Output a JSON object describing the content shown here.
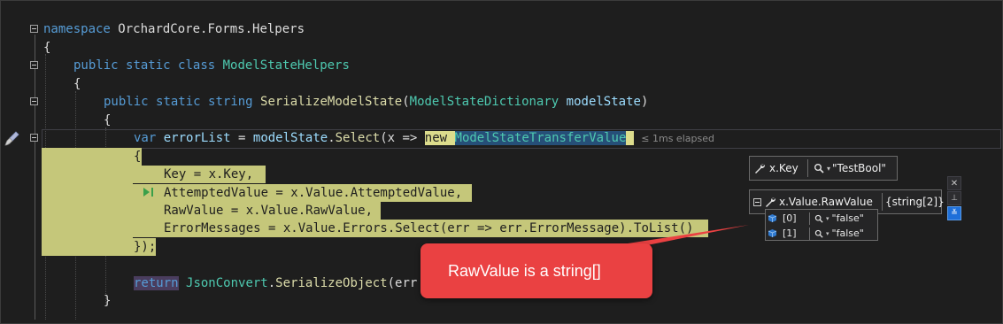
{
  "editor": {
    "lines": {
      "l1": {
        "kw": "namespace",
        "name": "OrchardCore.Forms.Helpers"
      },
      "l2": {
        "text": "{"
      },
      "l3": {
        "kw1": "public",
        "kw2": "static",
        "kw3": "class",
        "name": "ModelStateHelpers"
      },
      "l4": {
        "text": "{"
      },
      "l5": {
        "kw1": "public",
        "kw2": "static",
        "kw3": "string",
        "method": "SerializeModelState",
        "open": "(",
        "ptype": "ModelStateDictionary",
        "pname": "modelState",
        "close": ")"
      },
      "l6": {
        "text": "{"
      },
      "l7": {
        "kw": "var",
        "varname": "errorList",
        "eq": " = ",
        "obj": "modelState",
        "dot": ".",
        "call": "Select",
        "lambda_param": "(x",
        "arrow": " => ",
        "new_kw": "new",
        "type": "ModelStateTransferValue",
        "elapsed": "≤ 1ms elapsed"
      },
      "l8": {
        "text": "{"
      },
      "l9": {
        "text": "Key = x.Key,"
      },
      "l10": {
        "text": "AttemptedValue = x.Value.AttemptedValue,"
      },
      "l11": {
        "text": "RawValue = x.Value.RawValue,"
      },
      "l12": {
        "text": "ErrorMessages = x.Value.Errors.Select(err => err.ErrorMessage).ToList()"
      },
      "l13": {
        "text": "});"
      },
      "l15": {
        "kw": "return",
        "type": "JsonConvert",
        "dot": ".",
        "call": "SerializeObject",
        "args": "(err"
      },
      "l16": {
        "text": "}"
      }
    }
  },
  "datatips": {
    "key": {
      "name": "x.Key",
      "value": "\"TestBool\""
    },
    "rawvalue": {
      "name": "x.Value.RawValue",
      "value": "{string[2]}",
      "items": [
        {
          "index": "[0]",
          "value": "\"false\""
        },
        {
          "index": "[1]",
          "value": "\"false\""
        }
      ]
    }
  },
  "callout": {
    "text": "RawValue is a string[]"
  },
  "colors": {
    "callout": "#ea4142",
    "highlight": "#c5c77a",
    "keyword": "#569cd6",
    "type": "#4ec9b0"
  }
}
